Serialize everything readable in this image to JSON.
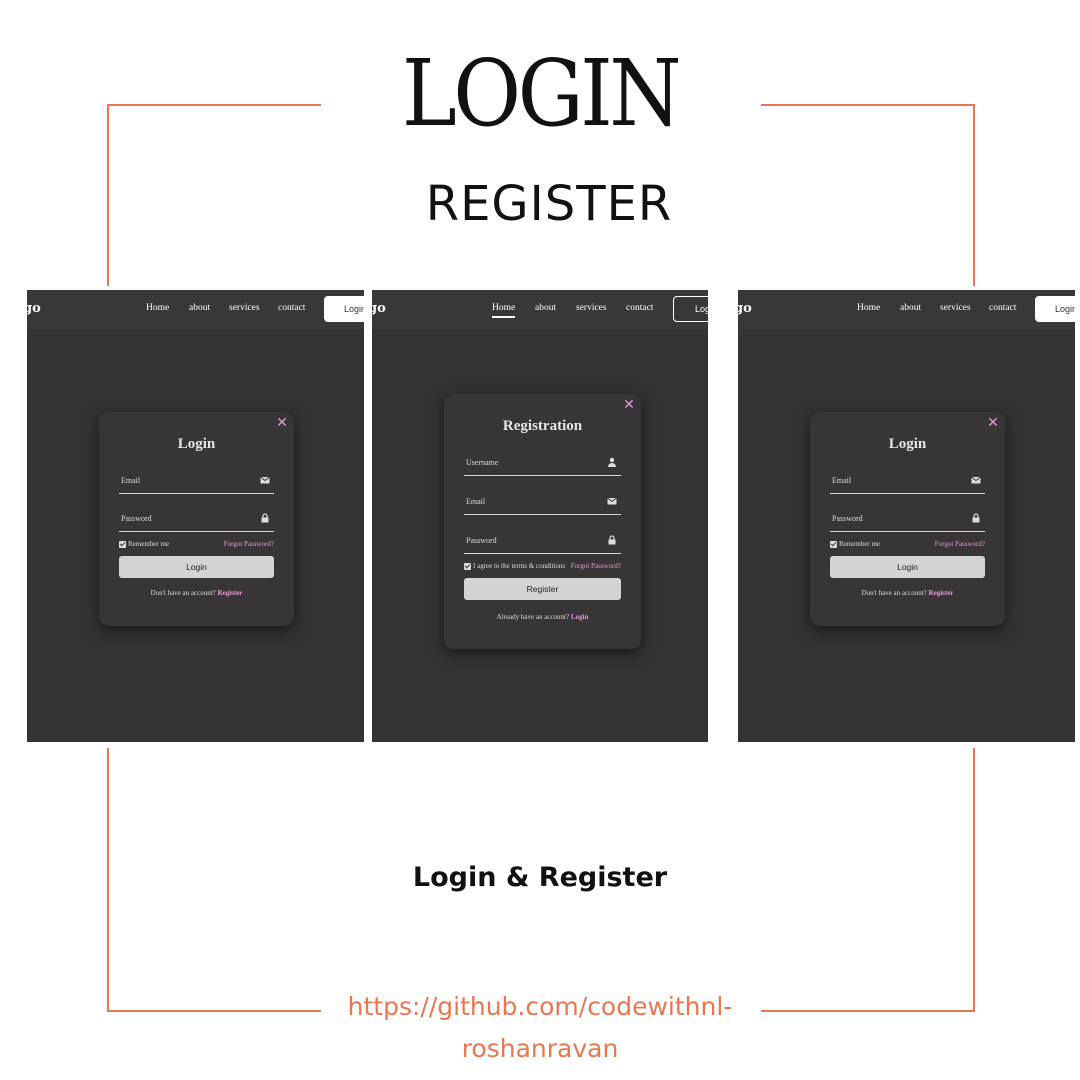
{
  "hero": {
    "title": "LOGIN",
    "subtitle": "REGISTER"
  },
  "caption": "Login & Register",
  "link": {
    "line1": "https://github.com/codewithnl-",
    "line2": "roshanravan"
  },
  "colors": {
    "accent": "#e8774f",
    "panel_bg": "#353233",
    "card_bg": "#383536",
    "link_pink": "#e39ad8"
  },
  "navbar": {
    "logo": "go",
    "links": [
      "Home",
      "about",
      "services",
      "contact"
    ],
    "button": "Login"
  },
  "login_form": {
    "title": "Login",
    "email_placeholder": "Email",
    "email_icon": "envelope-icon",
    "password_placeholder": "Password",
    "password_icon": "lock-icon",
    "remember": "Remember me",
    "forgot": "Forgot Password?",
    "submit": "Login",
    "switch_text": "Don't have an account?",
    "switch_link": "Register"
  },
  "register_form": {
    "title": "Registration",
    "username_placeholder": "Username",
    "username_icon": "user-icon",
    "email_placeholder": "Email",
    "password_placeholder": "Password",
    "agree": "I agree to the terms & conditions",
    "forgot": "Forgot Password?",
    "submit": "Register",
    "switch_text": "Already have an account?",
    "switch_link": "Login"
  }
}
